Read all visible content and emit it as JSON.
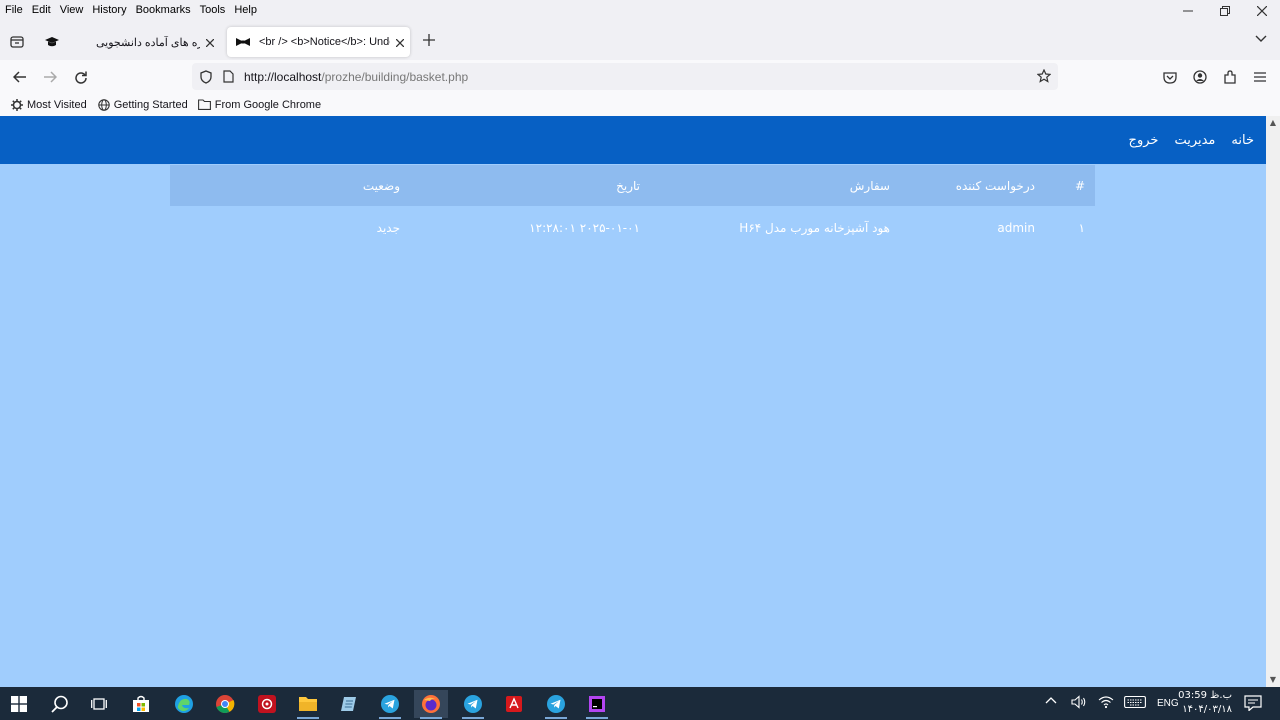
{
  "menubar": {
    "items": [
      "File",
      "Edit",
      "View",
      "History",
      "Bookmarks",
      "Tools",
      "Help"
    ]
  },
  "tabs": [
    {
      "title": "پروژه های آماده دانشجویی",
      "active": false
    },
    {
      "title": "<br /> <b>Notice</b>: Undefi",
      "active": true
    }
  ],
  "navbar": {
    "url_host": "http://localhost",
    "url_path": "/prozhe/building/basket.php"
  },
  "bookmarks": [
    {
      "label": "Most Visited",
      "icon": "gear-icon"
    },
    {
      "label": "Getting Started",
      "icon": "globe-icon"
    },
    {
      "label": "From Google Chrome",
      "icon": "folder-icon"
    }
  ],
  "site_nav": {
    "home": "خانه",
    "admin": "مدیریت",
    "logout": "خروج"
  },
  "orders_table": {
    "headers": {
      "num": "#",
      "requester": "درخواست کننده",
      "order": "سفارش",
      "date": "تاریخ",
      "status": "وضعیت"
    },
    "rows": [
      {
        "num": "۱",
        "requester": "admin",
        "order": "هود آشپزخانه مورب مدل H۶۴",
        "date": "۲۰۲۵-۰۱-۰۱ ۱۲:۲۸:۰۱",
        "status": "جدید"
      }
    ]
  },
  "taskbar": {
    "lang": "ENG",
    "time": "03:59 ب.ظ",
    "date": "۱۴۰۴/۰۳/۱۸"
  },
  "colors": {
    "site_nav_bg": "#0760c4",
    "content_bg": "#a0cdfd",
    "table_header_bg": "#8ebbef",
    "taskbar_bg": "#1b2a3a"
  }
}
